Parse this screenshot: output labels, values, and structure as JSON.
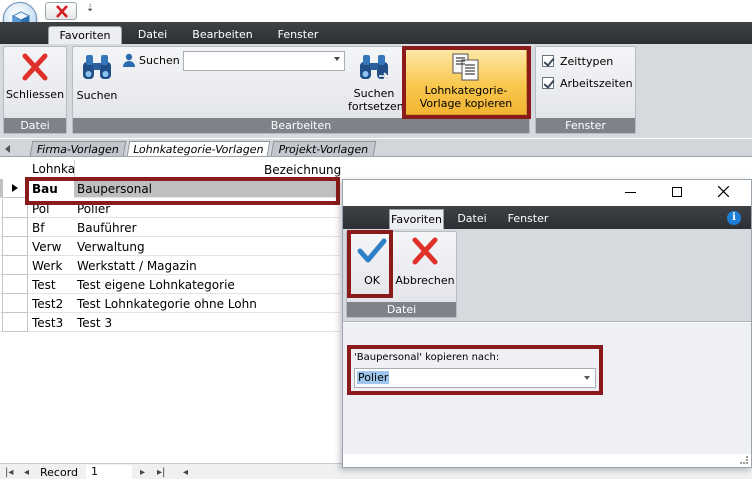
{
  "titlebar": {
    "close_icon": "close-icon",
    "qa_marker": "⇣"
  },
  "tabs": [
    "Favoriten",
    "Datei",
    "Bearbeiten",
    "Fenster"
  ],
  "ribbon": {
    "close_label": "Schliessen",
    "datei_group": "Datei",
    "search_label": "Suchen",
    "search_field_label": "Suchen",
    "search_field_value": "",
    "continue_label": "Suchen fortsetzen",
    "copy_label": "Lohnkategorie-Vorlage kopieren",
    "edit_group": "Bearbeiten",
    "check1": "Zeittypen",
    "check2": "Arbeitszeiten",
    "window_group": "Fenster"
  },
  "doc_tabs": [
    "Firma-Vorlagen",
    "Lohnkategorie-Vorlagen",
    "Projekt-Vorlagen"
  ],
  "grid": {
    "col1": "Lohnka",
    "col2": "Bezeichnung",
    "rows": [
      {
        "code": "Bau",
        "name": "Baupersonal"
      },
      {
        "code": "Pol",
        "name": "Polier"
      },
      {
        "code": "Bf",
        "name": "Bauführer"
      },
      {
        "code": "Verw",
        "name": "Verwaltung"
      },
      {
        "code": "Werk",
        "name": "Werkstatt / Magazin"
      },
      {
        "code": "Test",
        "name": "Test eigene Lohnkategorie"
      },
      {
        "code": "Test2",
        "name": "Test Lohnkategorie ohne Lohn"
      },
      {
        "code": "Test3",
        "name": "Test 3"
      }
    ]
  },
  "navigator": {
    "record_label": "Record",
    "record_value": "1"
  },
  "dialog": {
    "tabs": [
      "Favoriten",
      "Datei",
      "Fenster"
    ],
    "ok_label": "OK",
    "cancel_label": "Abbrechen",
    "group": "Datei",
    "copy_prompt": "'Baupersonal' kopieren nach:",
    "target_value": "Polier"
  },
  "colors": {
    "highlight": "#8b1a1a",
    "accent_orange": "#f7c04a",
    "dark_band": "#2f3236"
  }
}
